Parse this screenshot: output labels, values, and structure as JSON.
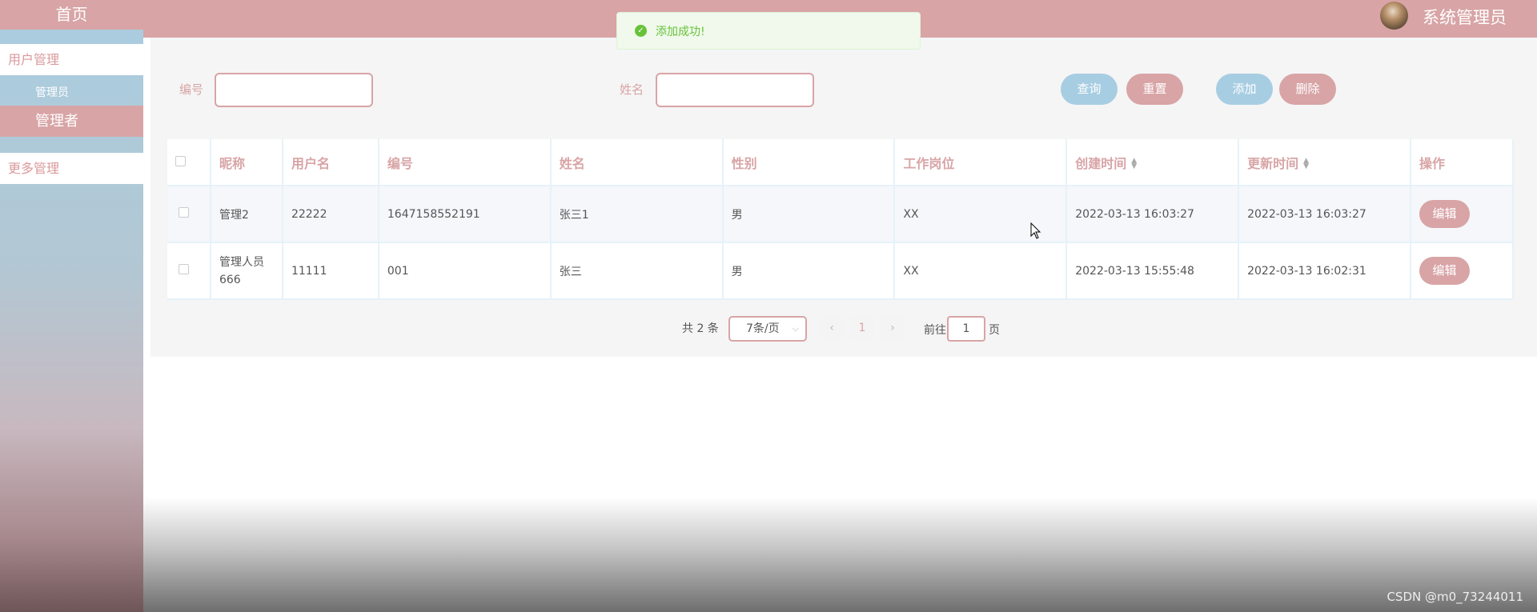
{
  "sidebar": {
    "home": "首页",
    "user_mgmt": "用户管理",
    "sub_admin": "管理员",
    "active_item": "管理者",
    "more_mgmt": "更多管理"
  },
  "header": {
    "user_name": "系统管理员"
  },
  "toast": {
    "message": "添加成功!"
  },
  "search": {
    "label_number": "编号",
    "label_name": "姓名",
    "query_button": "查询",
    "reset_button": "重置",
    "add_button": "添加",
    "delete_button": "删除"
  },
  "table": {
    "columns": [
      "昵称",
      "用户名",
      "编号",
      "姓名",
      "性别",
      "工作岗位",
      "创建时间",
      "更新时间",
      "操作"
    ],
    "rows": [
      {
        "nickname": "管理2",
        "username": "22222",
        "number": "1647158552191",
        "name": "张三1",
        "gender": "男",
        "job": "XX",
        "created": "2022-03-13 16:03:27",
        "updated": "2022-03-13 16:03:27",
        "action": "编辑"
      },
      {
        "nickname": "管理人员666",
        "username": "11111",
        "number": "001",
        "name": "张三",
        "gender": "男",
        "job": "XX",
        "created": "2022-03-13 15:55:48",
        "updated": "2022-03-13 16:02:31",
        "action": "编辑"
      }
    ]
  },
  "pagination": {
    "total": "共 2 条",
    "page_size": "7条/页",
    "current_page": "1",
    "goto_label": "前往",
    "goto_value": "1",
    "page_suffix": "页"
  },
  "watermark": "CSDN @m0_73244011",
  "colors": {
    "accent_pink": "#d8a4a6",
    "accent_blue": "#a7cde2",
    "success_green": "#67c23a"
  }
}
